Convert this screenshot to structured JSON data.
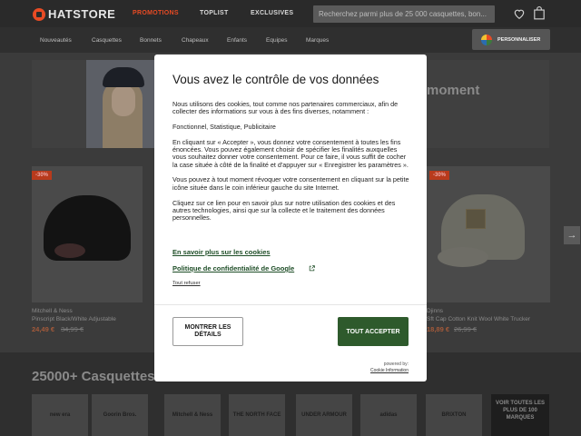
{
  "header": {
    "logo": "HATSTORE",
    "nav": {
      "promotions": "PROMOTIONS",
      "toplist": "TOPLIST",
      "exclusives": "EXCLUSIVES"
    },
    "search_placeholder": "Recherchez parmi plus de 25 000 casquettes, bon...",
    "icons": [
      "heart-icon",
      "shopping-bag-icon"
    ]
  },
  "subnav": {
    "categories": [
      "Nouveautés",
      "Casquettes",
      "Bonnets",
      "Chapeaux",
      "Enfants",
      "Equipes",
      "Marques"
    ],
    "personalize_label": "PERSONNALISER"
  },
  "hero": {
    "title_fragment": "moment"
  },
  "products": [
    {
      "badge": "-30%",
      "brand": "Mitchell & Ness",
      "name": "Pinscript Black/White Adjustable",
      "price": "24,49 €",
      "old_price": "34,99 €"
    },
    {
      "badge": "-30%",
      "brand": "Djinns",
      "name": "Sft Cap Cotton Knit Wool White Trucker",
      "price": "18,89 €",
      "old_price": "26,99 €"
    }
  ],
  "brands_section": {
    "title": "25000+ Casquettes",
    "brands": [
      "new era",
      "Goorin Bros.",
      "Mitchell & Ness",
      "THE NORTH FACE",
      "UNDER ARMOUR",
      "adidas",
      "BRIXTON"
    ],
    "see_all": "VOIR TOUTES LES PLUS DE 100 MARQUES"
  },
  "consent": {
    "title": "Vous avez le contrôle de vos données",
    "paragraphs": [
      "Nous utilisons des cookies, tout comme nos partenaires commerciaux, afin de collecter des informations sur vous à des fins diverses, notamment :",
      "Fonctionnel, Statistique, Publicitaire",
      "En cliquant sur « Accepter », vous donnez votre consentement à toutes les fins énoncées. Vous pouvez également choisir de spécifier les finalités auxquelles vous souhaitez donner votre consentement. Pour ce faire, il vous suffit de cocher la case située à côté de la finalité et d'appuyer sur « Enregistrer les paramètres ».",
      "Vous pouvez à tout moment révoquer votre consentement en cliquant sur la petite icône située dans le coin inférieur gauche du site Internet.",
      "Cliquez sur ce lien pour en savoir plus sur notre utilisation des cookies et des autres technologies, ainsi que sur la collecte et le traitement des données personnelles."
    ],
    "learn_more": "En savoir plus sur les cookies",
    "google_policy": "Politique de confidentialité de Google",
    "refuse": "Tout refuser",
    "show_details": "MONTRER LES DÉTAILS",
    "accept_all": "TOUT ACCEPTER",
    "powered_by": "powered by:",
    "powered_brand": "Cookie Information"
  }
}
